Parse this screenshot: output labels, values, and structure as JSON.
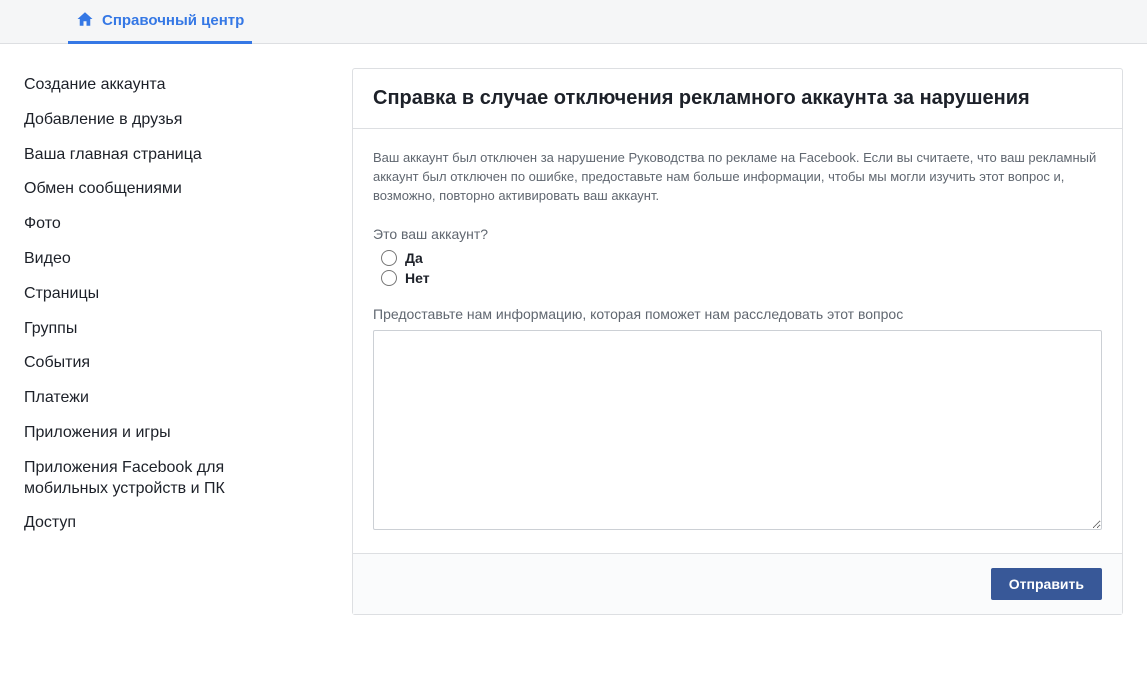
{
  "header": {
    "tab_label": "Справочный центр"
  },
  "sidebar": {
    "items": [
      {
        "label": "Создание аккаунта"
      },
      {
        "label": "Добавление в друзья"
      },
      {
        "label": "Ваша главная страница"
      },
      {
        "label": "Обмен сообщениями"
      },
      {
        "label": "Фото"
      },
      {
        "label": "Видео"
      },
      {
        "label": "Страницы"
      },
      {
        "label": "Группы"
      },
      {
        "label": "События"
      },
      {
        "label": "Платежи"
      },
      {
        "label": "Приложения и игры"
      },
      {
        "label": "Приложения Facebook для мобильных устройств и ПК"
      },
      {
        "label": "Доступ"
      }
    ]
  },
  "main": {
    "title": "Справка в случае отключения рекламного аккаунта за нарушения",
    "description": "Ваш аккаунт был отключен за нарушение Руководства по рекламе на Facebook. Если вы считаете, что ваш рекламный аккаунт был отключен по ошибке, предоставьте нам больше информации, чтобы мы могли изучить этот вопрос и, возможно, повторно активировать ваш аккаунт.",
    "question": "Это ваш аккаунт?",
    "option_yes": "Да",
    "option_no": "Нет",
    "info_label": "Предоставьте нам информацию, которая поможет нам расследовать этот вопрос",
    "textarea_value": "",
    "submit_label": "Отправить"
  }
}
